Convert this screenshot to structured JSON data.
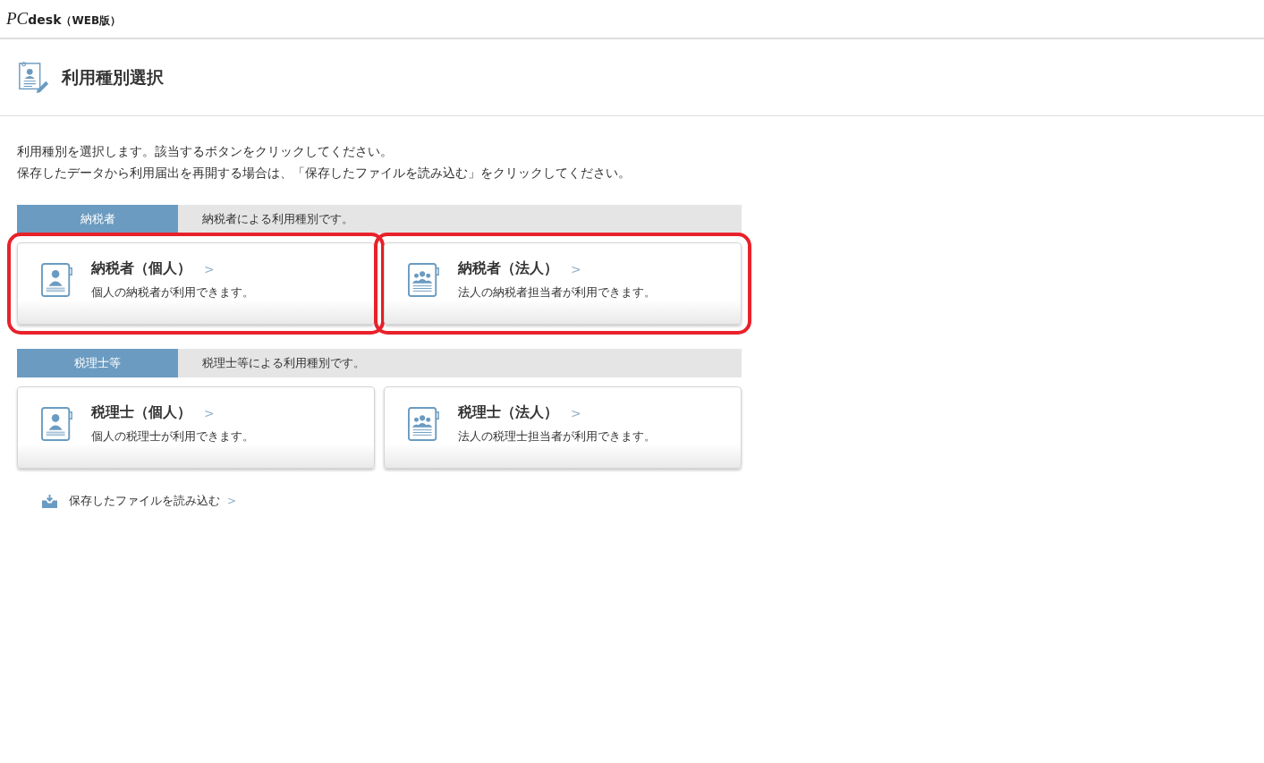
{
  "header": {
    "logo_script": "PC",
    "logo_word": "desk",
    "logo_suffix": "（WEB版）"
  },
  "page_title": "利用種別選択",
  "intro": [
    "利用種別を選択します。該当するボタンをクリックしてください。",
    "保存したデータから利用届出を再開する場合は、「保存したファイルを読み込む」をクリックしてください。"
  ],
  "sections": [
    {
      "label": "納税者",
      "description": "納税者による利用種別です。",
      "options": [
        {
          "kind": "individual",
          "title": "納税者（個人）",
          "arrow": ">",
          "subtitle": "個人の納税者が利用できます。",
          "highlighted": true
        },
        {
          "kind": "corporate",
          "title": "納税者（法人）",
          "arrow": ">",
          "subtitle": "法人の納税者担当者が利用できます。",
          "highlighted": true
        }
      ]
    },
    {
      "label": "税理士等",
      "description": "税理士等による利用種別です。",
      "options": [
        {
          "kind": "individual",
          "title": "税理士（個人）",
          "arrow": ">",
          "subtitle": "個人の税理士が利用できます。",
          "highlighted": false
        },
        {
          "kind": "corporate",
          "title": "税理士（法人）",
          "arrow": ">",
          "subtitle": "法人の税理士担当者が利用できます。",
          "highlighted": false
        }
      ]
    }
  ],
  "load_link": {
    "label": "保存したファイルを読み込む",
    "arrow": ">"
  }
}
